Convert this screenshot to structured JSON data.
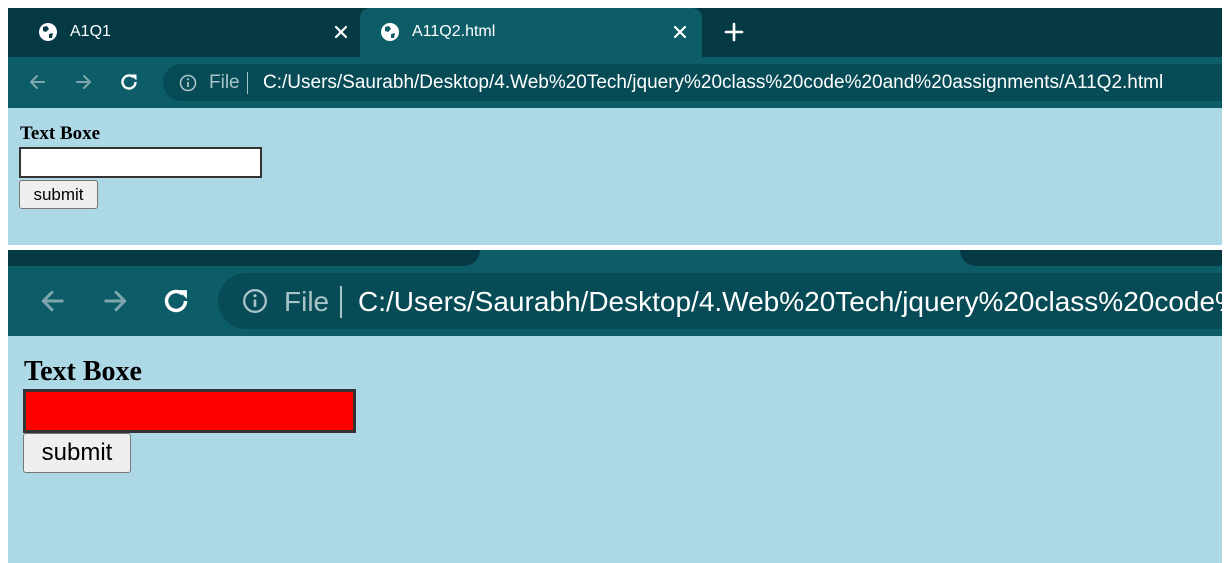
{
  "browser": {
    "tabs": [
      {
        "title": "A1Q1",
        "icon": "globe-icon",
        "active": false
      },
      {
        "title": "A11Q2.html",
        "icon": "globe-icon",
        "active": true
      }
    ],
    "new_tab_icon": "plus-icon",
    "nav": {
      "back_icon": "arrow-left-icon",
      "forward_icon": "arrow-right-icon",
      "reload_icon": "reload-icon"
    },
    "address": {
      "info_icon": "info-icon",
      "scheme_label": "File",
      "url": "C:/Users/Saurabh/Desktop/4.Web%20Tech/jquery%20class%20code%20and%20assignments/A11Q2.html",
      "url_truncated": "C:/Users/Saurabh/Desktop/4.Web%20Tech/jquery%20class%20code%20"
    }
  },
  "page_before": {
    "heading": "Text Boxe",
    "input_value": "",
    "input_background": "#ffffff",
    "button_label": "submit"
  },
  "page_after": {
    "heading": "Text Boxe",
    "input_value": "",
    "input_background": "#ff0000",
    "button_label": "submit"
  },
  "colors": {
    "tab_strip": "#053a44",
    "toolbar": "#0d5d68",
    "omnibox": "#064b55",
    "page_background": "#add8e6"
  }
}
